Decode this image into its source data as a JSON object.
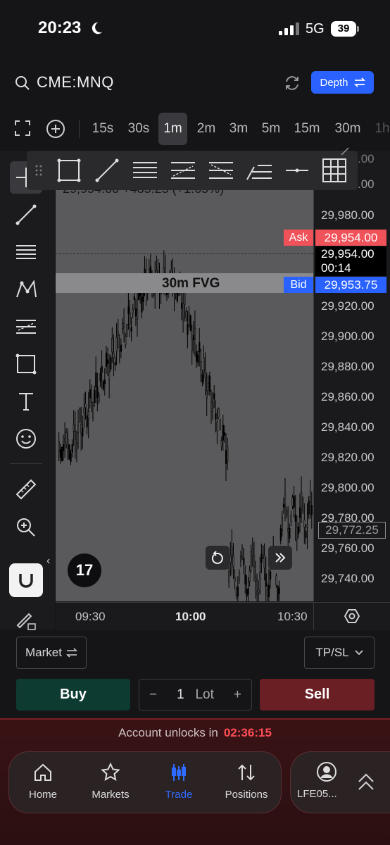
{
  "status_bar": {
    "time": "20:23",
    "network": "5G",
    "battery": "39"
  },
  "header": {
    "symbol": "CME:MNQ",
    "depth_label": "Depth"
  },
  "timeframes": [
    "15s",
    "30s",
    "1m",
    "2m",
    "3m",
    "5m",
    "15m",
    "30m",
    "1h"
  ],
  "selected_timeframe": "1m",
  "chart": {
    "quote_line": "29,954.00  +485.25 (+1.65%)",
    "fvg_label": "30m FVG",
    "price_ticks": [
      "29,980.00",
      "29,920.00",
      "29,900.00",
      "29,880.00",
      "29,860.00",
      "29,840.00",
      "29,820.00",
      "29,800.00",
      "29,780.00",
      "29,760.00",
      "29,740.00"
    ],
    "axis_top_partial": [
      "29,000.00",
      "29,000.00"
    ],
    "ask_label": "Ask",
    "ask_price": "29,954.00",
    "last_price": "29,954.00",
    "countdown": "00:14",
    "bid_label": "Bid",
    "bid_price": "29,953.75",
    "hover_price": "29,772.25",
    "time_ticks": [
      "09:30",
      "10:00",
      "10:30"
    ],
    "logo_text": "17"
  },
  "order_panel": {
    "order_type": "Market",
    "tpsl_label": "TP/SL",
    "buy_label": "Buy",
    "sell_label": "Sell",
    "qty": "1",
    "qty_unit": "Lot",
    "minus": "−",
    "plus": "+"
  },
  "unlock": {
    "text": "Account unlocks in",
    "countdown": "02:36:15"
  },
  "nav": {
    "items": [
      {
        "label": "Home",
        "icon": "home-icon"
      },
      {
        "label": "Markets",
        "icon": "star-icon"
      },
      {
        "label": "Trade",
        "icon": "candles-icon",
        "active": true
      },
      {
        "label": "Positions",
        "icon": "positions-icon"
      }
    ],
    "account_label": "LFE05..."
  },
  "colors": {
    "accent": "#2962ff",
    "ask": "#f0525a",
    "bid": "#2962ff",
    "buy": "#0d3b31",
    "sell": "#6a1f25",
    "countdown": "#ff4d55"
  }
}
